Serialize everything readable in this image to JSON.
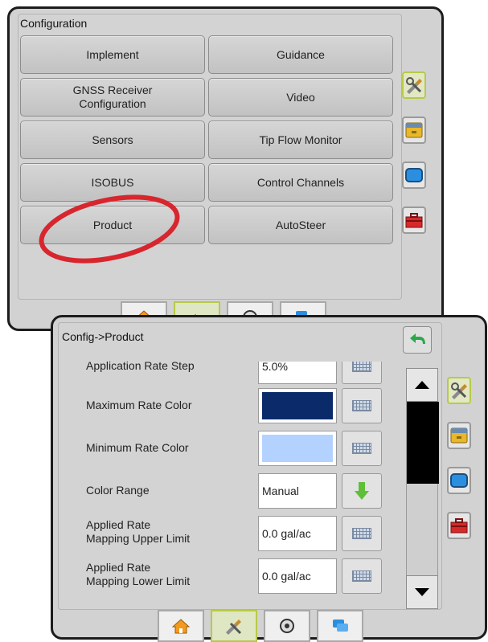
{
  "config_panel": {
    "title": "Configuration",
    "buttons": [
      {
        "label": "Implement"
      },
      {
        "label": "Guidance"
      },
      {
        "label": "GNSS Receiver\nConfiguration"
      },
      {
        "label": "Video"
      },
      {
        "label": "Sensors"
      },
      {
        "label": "Tip Flow Monitor"
      },
      {
        "label": "ISOBUS"
      },
      {
        "label": "Control Channels"
      },
      {
        "label": "Product"
      },
      {
        "label": "AutoSteer"
      }
    ],
    "highlight_color": "#d8262e"
  },
  "product_panel": {
    "title": "Config->Product",
    "settings": [
      {
        "label": "Application Rate Step",
        "value": "5.0%"
      },
      {
        "label": "Maximum Rate Color",
        "color": "#0a2a6a"
      },
      {
        "label": "Minimum Rate Color",
        "color": "#b4d2ff"
      },
      {
        "label": "Color Range",
        "value": "Manual"
      },
      {
        "label": "Applied Rate\nMapping Upper Limit",
        "value": "0.0 gal/ac"
      },
      {
        "label": "Applied Rate\nMapping Lower Limit",
        "value": "0.0 gal/ac"
      }
    ]
  },
  "side_buttons": [
    {
      "icon": "tools-icon",
      "active": true
    },
    {
      "icon": "drawer-icon"
    },
    {
      "icon": "screen-icon"
    },
    {
      "icon": "toolbox-icon"
    }
  ],
  "bottom_tabs": [
    {
      "icon": "home-icon"
    },
    {
      "icon": "tools-icon",
      "active": true
    },
    {
      "icon": "gauge-icon"
    },
    {
      "icon": "chat-icon"
    }
  ],
  "colors": {
    "accent": "#b8c94a",
    "panel_bg": "#d2d2d2",
    "arrow_green": "#5fbf3a"
  }
}
